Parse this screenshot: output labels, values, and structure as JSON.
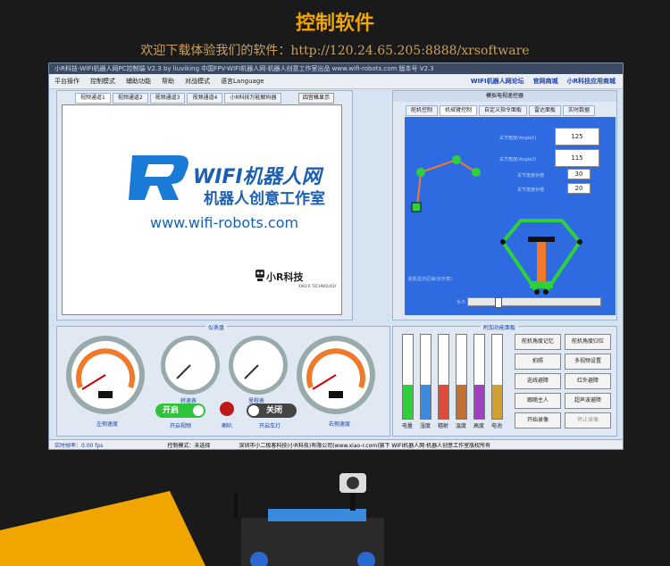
{
  "hero": {
    "title": "控制软件",
    "subtitle": "欢迎下载体验我们的软件：http://120.24.65.205:8888/xrsoftware"
  },
  "window": {
    "title": "小R科技-WIFI机器人网PC控制端 V2.3 by liuviking 中国FPV-WIFI机器人网·机器人创意工作室出品 www.wifi-robots.com 版本号 V2.3",
    "menu": [
      "平台操作",
      "控制模式",
      "辅助功能",
      "帮助",
      "对战模式",
      "语言Language"
    ],
    "links": [
      "WIFI机器人网论坛",
      "官网商城",
      "小R科技应用商城"
    ]
  },
  "video": {
    "tabs": [
      "视频通道1",
      "视频通道2",
      "视频通道3",
      "视频通道4",
      "小R科技万能解码器"
    ],
    "quad_button": "四宫格显示",
    "logo_text": "WIFI机器人网",
    "logo_cn": "机器人创意工作室",
    "logo_url": "www.wifi-robots.com",
    "xr_text": "小R科技",
    "xr_sub": "XIAO R TECHNOLOGY"
  },
  "right_panel": {
    "header": "模拟电视遥控器",
    "tabs": [
      "舵机控制",
      "机械臂控制",
      "自定义指令面板",
      "雷达面板",
      "实时数据"
    ],
    "angle1_label": "关节角度(Angle1)",
    "angle1_value": "125",
    "angle2_label": "关节角度(Angle2)",
    "angle2_value": "115",
    "speed_label": "关节角度补偿",
    "speed_value": "30",
    "speed2_label": "关节角度补偿",
    "speed2_value": "20",
    "bottom_label": "舵机显示区域(仅示意)",
    "slider_label": "手爪"
  },
  "dashboard": {
    "title": "仪表盘",
    "left_label": "左侧速度",
    "speed_label": "转速表",
    "mileage_label": "里程表",
    "right_label": "右侧速度",
    "on_label": "开启",
    "off_label": "关闭",
    "cam_label": "开启视频",
    "horn_label": "喇叭",
    "light_label": "开启车灯",
    "gauge_ticks": [
      "0",
      "20",
      "40",
      "60",
      "80",
      "100"
    ]
  },
  "aux": {
    "title": "附加功能面板",
    "bars": [
      {
        "label": "电量",
        "value": "50",
        "color": "#2ed13a"
      },
      {
        "label": "湿度",
        "value": "20",
        "color": "#3a8be0"
      },
      {
        "label": "辐射",
        "value": "0",
        "color": "#e04a3a"
      },
      {
        "label": "温度",
        "value": "0",
        "color": "#c07030"
      },
      {
        "label": "高度",
        "value": "0",
        "color": "#a040c0"
      },
      {
        "label": "电池",
        "value": "0",
        "color": "#d0a030"
      }
    ],
    "buttons": [
      "舵机角度记忆",
      "舵机角度归位",
      "拍照",
      "多视频设置",
      "巡线避障",
      "红外避障",
      "跟随主人",
      "超声波避障",
      "开始录像",
      "停止录像"
    ]
  },
  "status": {
    "fps": "实时帧率：0.00 fps",
    "mode": "控制模式：未选择",
    "copyright": "深圳市小二极客科技(小R科技)有限公司(www.xiao-r.com)旗下 WIFI机器人网·机器人创意工作室版权所有"
  },
  "colors": {
    "accent": "#f0a500",
    "window_bg": "#d6e3f1",
    "blue_panel": "#2f6be0",
    "arm": "#f07a2a",
    "joint": "#2ed13a"
  }
}
